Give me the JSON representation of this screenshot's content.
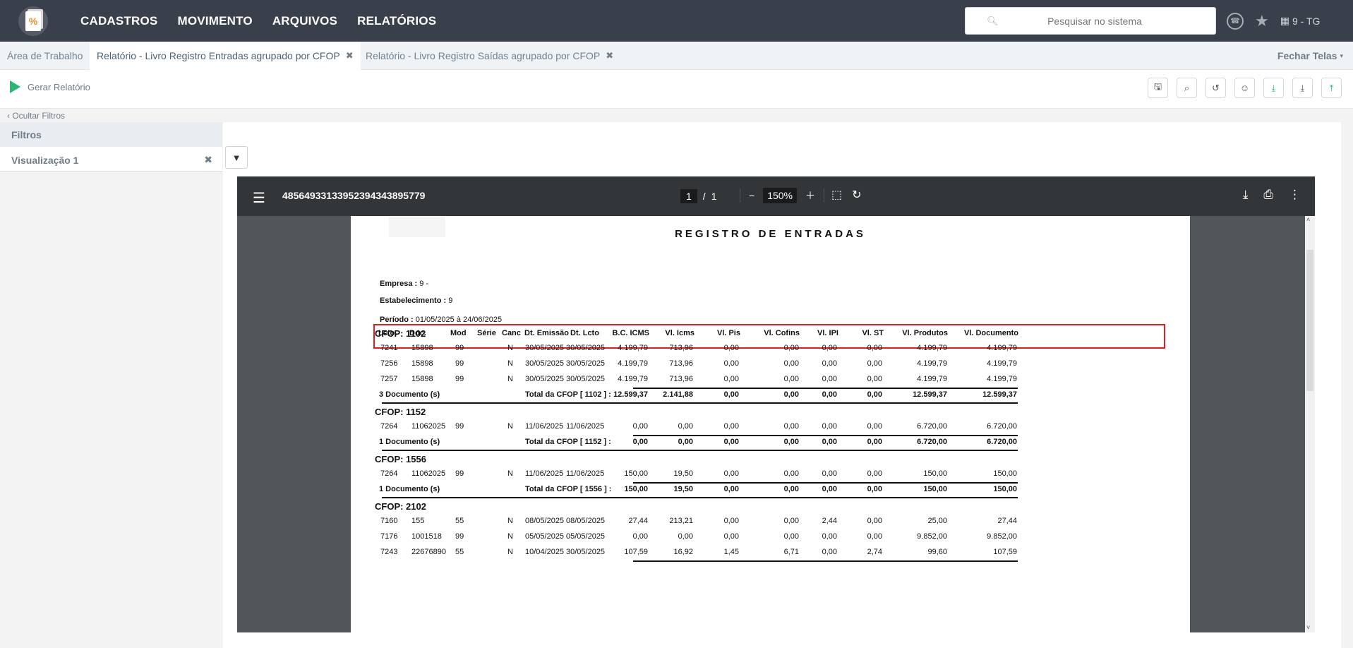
{
  "topbar": {
    "logo_symbol": "%",
    "menu": [
      "CADASTROS",
      "MOVIMENTO",
      "ARQUIVOS",
      "RELATÓRIOS"
    ],
    "search_placeholder": "Pesquisar no sistema",
    "store_label": "9 - TG"
  },
  "tabs": {
    "items": [
      {
        "label": "Área de Trabalho",
        "closable": false
      },
      {
        "label": "Relatório - Livro Registro Entradas agrupado por CFOP",
        "closable": true
      },
      {
        "label": "Relatório - Livro Registro Saídas agrupado por CFOP",
        "closable": true
      }
    ],
    "close_all": "Fechar Telas"
  },
  "toolbar": {
    "generate_label": "Gerar Relatório"
  },
  "sidebar": {
    "hide_filters": "Ocultar Filtros",
    "filters_title": "Filtros",
    "view_label": "Visualização 1"
  },
  "viewer": {
    "filename": "48564933133952394343895779",
    "page_current": "1",
    "page_sep": "/",
    "page_total": "1",
    "zoom": "150%"
  },
  "report": {
    "title": "REGISTRO DE ENTRADAS",
    "empresa_label": "Empresa :",
    "empresa_value": "9 -",
    "estab_label": "Estabelecimento :",
    "estab_value": "9",
    "periodo_label": "Período :",
    "periodo_value": "01/05/2025 à 24/06/2025",
    "columns": [
      "Lcto.",
      "Doc.",
      "Mod",
      "Série",
      "Canc",
      "Dt. Emissão",
      "Dt. Lcto",
      "B.C. ICMS",
      "Vl. Icms",
      "Vl. Pis",
      "Vl. Cofins",
      "Vl. IPI",
      "Vl. ST",
      "Vl. Produtos",
      "Vl. Documento"
    ],
    "groups": [
      {
        "cfop": "CFOP: 1102",
        "rows": [
          [
            "7241",
            "15898",
            "99",
            "",
            "N",
            "30/05/2025",
            "30/05/2025",
            "4.199,79",
            "713,96",
            "0,00",
            "0,00",
            "0,00",
            "0,00",
            "4.199,79",
            "4.199,79"
          ],
          [
            "7256",
            "15898",
            "99",
            "",
            "N",
            "30/05/2025",
            "30/05/2025",
            "4.199,79",
            "713,96",
            "0,00",
            "0,00",
            "0,00",
            "0,00",
            "4.199,79",
            "4.199,79"
          ],
          [
            "7257",
            "15898",
            "99",
            "",
            "N",
            "30/05/2025",
            "30/05/2025",
            "4.199,79",
            "713,96",
            "0,00",
            "0,00",
            "0,00",
            "0,00",
            "4.199,79",
            "4.199,79"
          ]
        ],
        "total_docs": "3 Documento (s)",
        "total_label": "Total da CFOP [ 1102 ] :",
        "totals": [
          "12.599,37",
          "2.141,88",
          "0,00",
          "0,00",
          "0,00",
          "0,00",
          "12.599,37",
          "12.599,37"
        ]
      },
      {
        "cfop": "CFOP: 1152",
        "rows": [
          [
            "7264",
            "11062025",
            "99",
            "",
            "N",
            "11/06/2025",
            "11/06/2025",
            "0,00",
            "0,00",
            "0,00",
            "0,00",
            "0,00",
            "0,00",
            "6.720,00",
            "6.720,00"
          ]
        ],
        "total_docs": "1 Documento (s)",
        "total_label": "Total da CFOP [ 1152 ] :",
        "totals": [
          "0,00",
          "0,00",
          "0,00",
          "0,00",
          "0,00",
          "0,00",
          "6.720,00",
          "6.720,00"
        ]
      },
      {
        "cfop": "CFOP: 1556",
        "rows": [
          [
            "7264",
            "11062025",
            "99",
            "",
            "N",
            "11/06/2025",
            "11/06/2025",
            "150,00",
            "19,50",
            "0,00",
            "0,00",
            "0,00",
            "0,00",
            "150,00",
            "150,00"
          ]
        ],
        "total_docs": "1 Documento (s)",
        "total_label": "Total da CFOP [ 1556 ] :",
        "totals": [
          "150,00",
          "19,50",
          "0,00",
          "0,00",
          "0,00",
          "0,00",
          "150,00",
          "150,00"
        ]
      },
      {
        "cfop": "CFOP: 2102",
        "rows": [
          [
            "7160",
            "155",
            "55",
            "",
            "N",
            "08/05/2025",
            "08/05/2025",
            "27,44",
            "213,21",
            "0,00",
            "0,00",
            "2,44",
            "0,00",
            "25,00",
            "27,44"
          ],
          [
            "7176",
            "1001518",
            "99",
            "",
            "N",
            "05/05/2025",
            "05/05/2025",
            "0,00",
            "0,00",
            "0,00",
            "0,00",
            "0,00",
            "0,00",
            "9.852,00",
            "9.852,00"
          ],
          [
            "7243",
            "22676890",
            "55",
            "",
            "N",
            "10/04/2025",
            "30/05/2025",
            "107,59",
            "16,92",
            "1,45",
            "6,71",
            "0,00",
            "2,74",
            "99,60",
            "107,59"
          ]
        ]
      }
    ]
  }
}
